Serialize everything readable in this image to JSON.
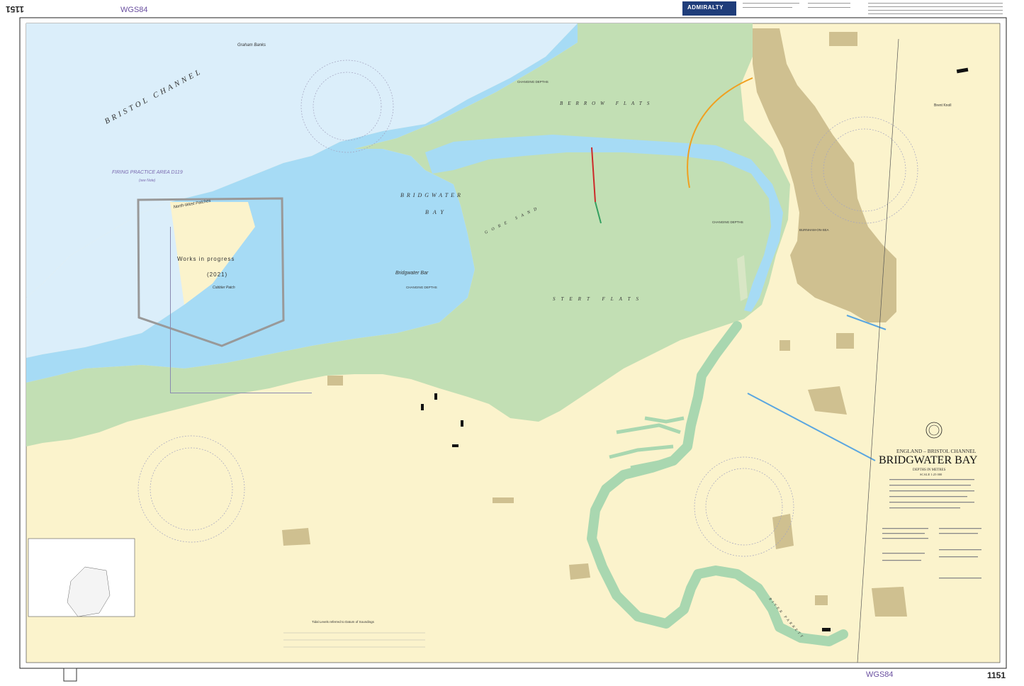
{
  "chart": {
    "number": "1151",
    "number_rotated": "1151",
    "datum": "WGS84",
    "datum_bottom": "WGS84",
    "brand": "ADMIRALTY",
    "title_region": "ENGLAND – BRISTOL CHANNEL",
    "title": "BRIDGWATER BAY",
    "depths_note": "DEPTHS IN METRES",
    "scale": "SCALE 1:25 000"
  },
  "labels": {
    "bristol_channel": "BRISTOL CHANNEL",
    "graham_banks": "Graham Banks",
    "firing_area": "FIRING PRACTICE AREA D119",
    "see_note": "(see Note)",
    "north_west_patches": "North-West Patches",
    "works": "Works in progress",
    "works_year": "(2021)",
    "cobbler_patch": "Cobbler Patch",
    "bridgwater_bay": "BRIDGWATER",
    "bay": "BAY",
    "bridgwater_bar": "Bridgwater Bar",
    "changing_depths": "CHANGING DEPTHS",
    "berrow_flats": "BERROW FLATS",
    "stert_flats": "STERT FLATS",
    "gore_sand": "GORE SAND",
    "burnham": "BURNHAM-ON-SEA",
    "brent_knoll": "Brent Knoll",
    "river_parrett": "RIVER PARRETT",
    "tidal_levels": "Tidal Levels referred to Datum of Soundings"
  },
  "colors": {
    "deep_water": "#dbeefa",
    "shallow_water": "#a6dbf5",
    "drying": "#c2dfb4",
    "land": "#fbf3cc",
    "builtup": "#cfc090",
    "red_line": "#cc2a2a",
    "orange_arc": "#f0a020"
  }
}
